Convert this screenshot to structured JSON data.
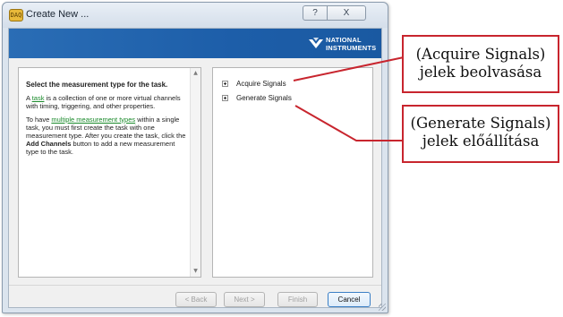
{
  "window": {
    "title": "Create New ...",
    "app_icon_text": "DAQ",
    "help_button": "?",
    "close_button": "X"
  },
  "banner": {
    "brand_line1": "NATIONAL",
    "brand_line2": "INSTRUMENTS",
    "color": "#1d5ea9"
  },
  "help": {
    "heading": "Select the measurement type for the task.",
    "p1_prefix": "A ",
    "p1_link": "task",
    "p1_rest": " is a collection of one or more virtual channels with timing, triggering, and other properties.",
    "p2_prefix": "To have ",
    "p2_link": "multiple measurement types",
    "p2_mid": " within a single task, you must first create the task with one measurement type. After you create the task, click the ",
    "p2_bold": "Add Channels",
    "p2_end": " button to add a new measurement type to the task."
  },
  "tree": {
    "items": [
      {
        "label": "Acquire Signals"
      },
      {
        "label": "Generate Signals"
      }
    ]
  },
  "buttons": {
    "back": "< Back",
    "next": "Next >",
    "finish": "Finish",
    "cancel": "Cancel"
  },
  "callouts": [
    {
      "line1": "(Acquire Signals)",
      "line2": "jelek beolvasása"
    },
    {
      "line1": "(Generate Signals)",
      "line2": "jelek előállítása"
    }
  ],
  "colors": {
    "callout_border": "#c8252e",
    "link": "#1a8a2b"
  }
}
